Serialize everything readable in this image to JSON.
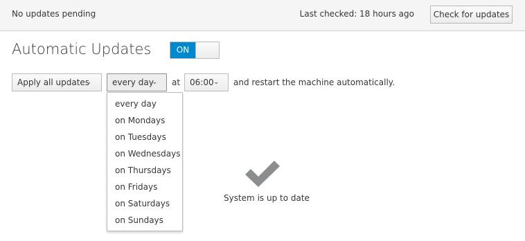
{
  "status": {
    "pending_text": "No updates pending",
    "last_checked": "Last checked: 18 hours ago",
    "check_button": "Check for updates"
  },
  "auto_updates": {
    "title": "Automatic Updates",
    "toggle_label": "ON",
    "toggle_state": "on",
    "toggle_color": "#0088ce",
    "type_selected": "Apply all updates",
    "day_selected": "every day",
    "at_label": "at",
    "time_selected": "06:00",
    "restart_text": "and restart the machine automatically.",
    "day_options": [
      "every day",
      "on Mondays",
      "on Tuesdays",
      "on Wednesdays",
      "on Thursdays",
      "on Fridays",
      "on Saturdays",
      "on Sundays"
    ]
  },
  "result": {
    "icon": "checkmark-icon",
    "icon_color": "#8b8d8f",
    "message": "System is up to date"
  }
}
